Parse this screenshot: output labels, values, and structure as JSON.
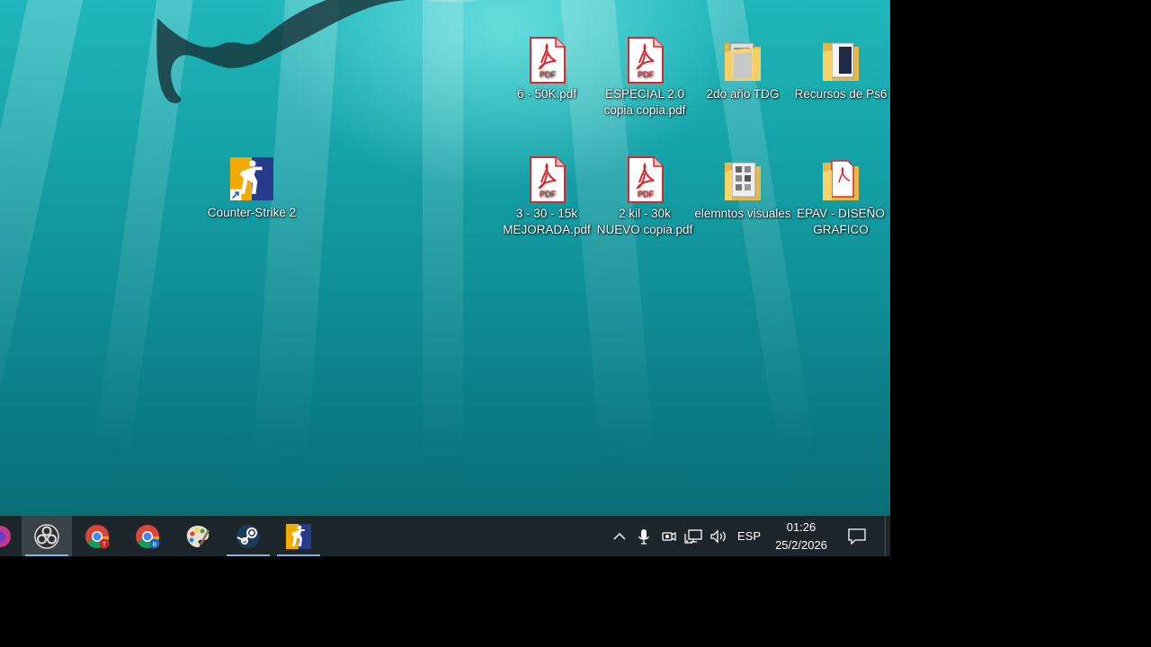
{
  "desktop": {
    "icons": [
      {
        "label": "Counter-Strike 2",
        "type": "shortcut-cs2"
      },
      {
        "label": "6 - 50K.pdf",
        "type": "pdf"
      },
      {
        "label": "ESPECIAL  2.0\ncopia copia.pdf",
        "type": "pdf"
      },
      {
        "label": "2do año TDG",
        "type": "folder"
      },
      {
        "label": "Recursos de Ps6",
        "type": "folder"
      },
      {
        "label": "3 - 30 - 15k\nMEJORADA.pdf",
        "type": "pdf"
      },
      {
        "label": "2 kil - 30k\nNUEVO copia.pdf",
        "type": "pdf"
      },
      {
        "label": "elemntos visuales",
        "type": "folder"
      },
      {
        "label": "EPAV - DISEÑO\nGRAFICO",
        "type": "folder"
      }
    ],
    "pdf_badge": "PDF"
  },
  "taskbar": {
    "apps": [
      {
        "name": "app-partial-icon"
      },
      {
        "name": "obs-icon",
        "active": true
      },
      {
        "name": "chrome-icon-profile-t",
        "badge": "T"
      },
      {
        "name": "chrome-icon-profile-b",
        "badge": "B"
      },
      {
        "name": "paint-icon"
      },
      {
        "name": "steam-icon",
        "running": true
      },
      {
        "name": "cs2-icon",
        "running": true
      }
    ],
    "tray": {
      "language": "ESP",
      "time": "01:26",
      "date": "25/2/2026"
    }
  },
  "colors": {
    "taskbar_bg": "#1d262b",
    "active_underline": "#76b9ed",
    "pdf_red": "#d9272e"
  }
}
